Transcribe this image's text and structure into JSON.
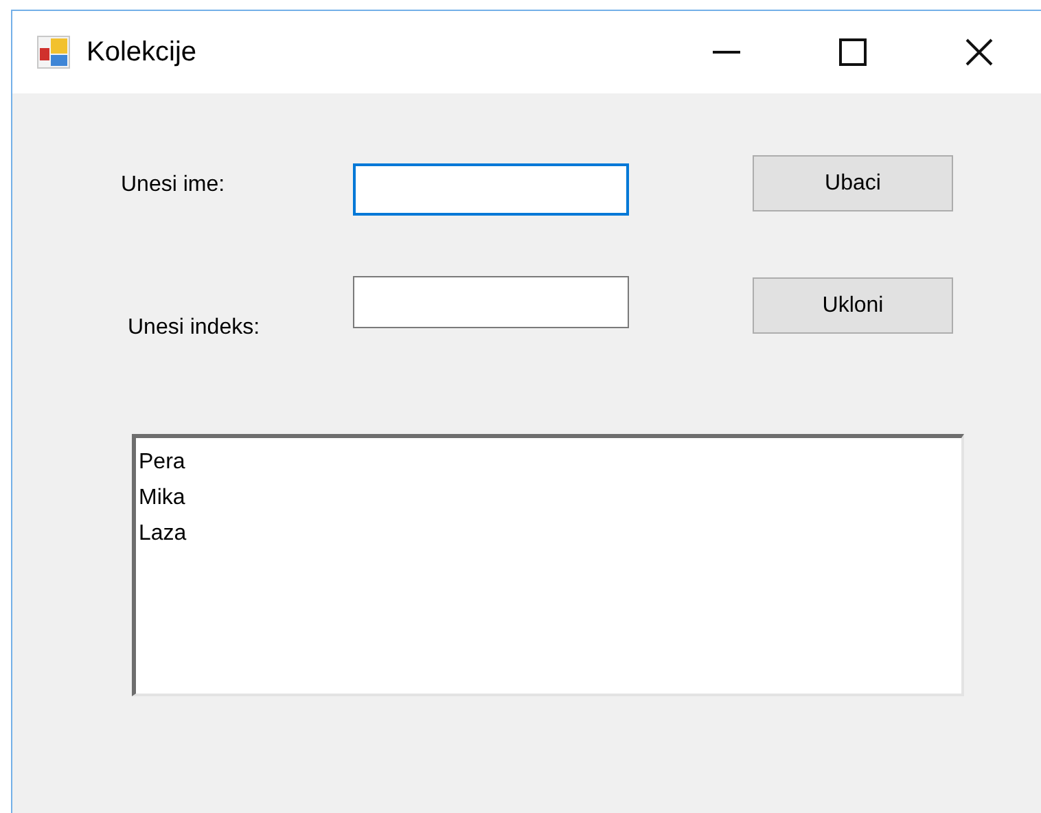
{
  "window": {
    "title": "Kolekcije",
    "controls": [
      {
        "kind": "minimize"
      },
      {
        "kind": "maximize"
      },
      {
        "kind": "close"
      }
    ]
  },
  "rows": [
    {
      "label": "Unesi ime:",
      "field": {
        "focused": true
      },
      "button": "Ubaci"
    },
    {
      "label": "Unesi indeks:",
      "field": {
        "focused": false
      },
      "button": "Ukloni"
    }
  ],
  "list": {
    "items": [
      "Pera",
      "Mika",
      "Laza"
    ]
  }
}
